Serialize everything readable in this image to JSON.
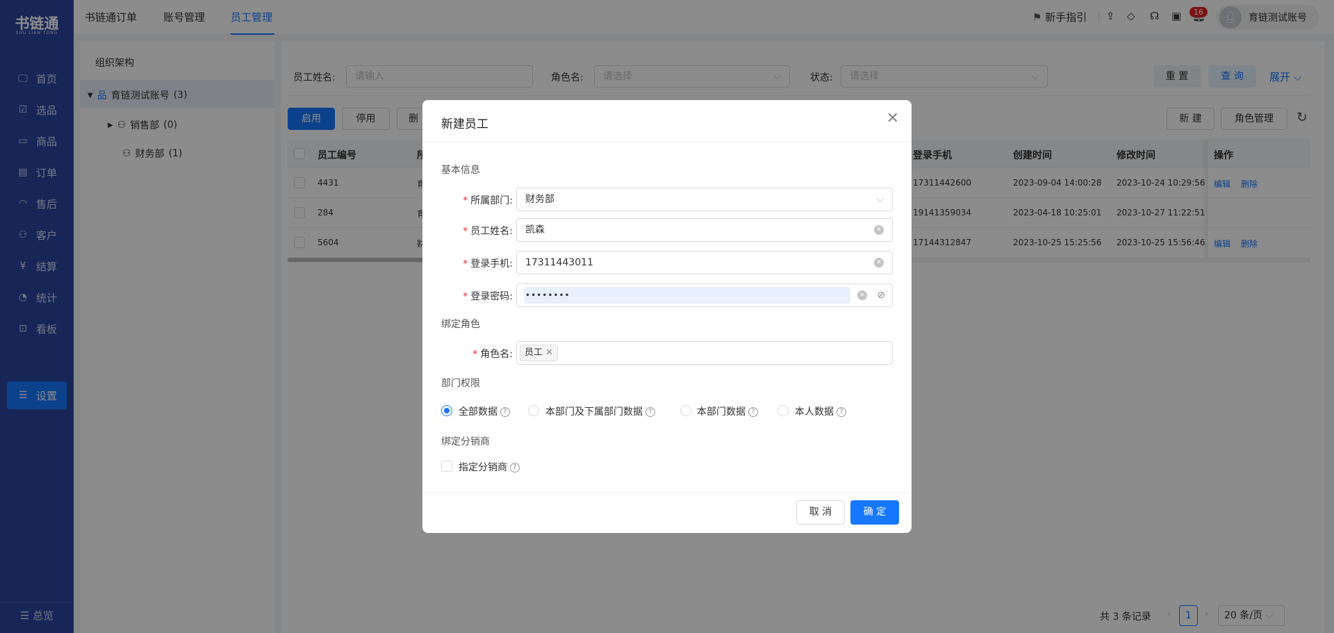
{
  "sidebar": {
    "logo": "书链通",
    "logo_sub": "SHU LIAN TONG",
    "items": [
      {
        "label": "首页",
        "icon": "monitor-icon"
      },
      {
        "label": "选品",
        "icon": "checklist-icon"
      },
      {
        "label": "商品",
        "icon": "box-icon"
      },
      {
        "label": "订单",
        "icon": "order-icon"
      },
      {
        "label": "售后",
        "icon": "headset-icon"
      },
      {
        "label": "客户",
        "icon": "users-icon"
      },
      {
        "label": "结算",
        "icon": "yuan-cycle-icon"
      },
      {
        "label": "统计",
        "icon": "pie-chart-icon"
      },
      {
        "label": "看板",
        "icon": "dashboard-icon"
      },
      {
        "label": "设置",
        "icon": "sliders-icon",
        "active": true
      }
    ],
    "overview": "总览"
  },
  "topbar": {
    "tabs": [
      "书链通订单",
      "账号管理",
      "员工管理"
    ],
    "active_tab": 2,
    "guide": "新手指引",
    "badge": "16",
    "account": "育链测试账号"
  },
  "tree": {
    "title": "组织架构",
    "root": "育链测试账号",
    "root_count": "(3)",
    "children": [
      {
        "label": "销售部",
        "count": "(0)"
      },
      {
        "label": "财务部",
        "count": "(1)"
      }
    ]
  },
  "filters": {
    "name_label": "员工姓名:",
    "name_placeholder": "请输入",
    "role_label": "角色名:",
    "role_placeholder": "请选择",
    "status_label": "状态:",
    "status_placeholder": "请选择",
    "reset": "重 置",
    "query": "查 询",
    "expand": "展开"
  },
  "actions": {
    "enable": "启用",
    "disable": "停用",
    "delete": "删",
    "create": "新 建",
    "roles": "角色管理"
  },
  "table": {
    "headers": [
      "员工编号",
      "所",
      "登录手机",
      "创建时间",
      "修改时间",
      "操作"
    ],
    "rows": [
      {
        "id": "4431",
        "dept": "育",
        "phone": "17311442600",
        "created": "2023-09-04 14:00:28",
        "modified": "2023-10-24 10:29:56",
        "ops": [
          "编辑",
          "删除"
        ]
      },
      {
        "id": "284",
        "dept": "育",
        "phone": "19141359034",
        "created": "2023-04-18 10:25:01",
        "modified": "2023-10-27 11:22:51",
        "ops": []
      },
      {
        "id": "5604",
        "dept": "财",
        "phone": "17144312847",
        "created": "2023-10-25 15:25:56",
        "modified": "2023-10-25 15:56:46",
        "ops": [
          "编辑",
          "删除"
        ]
      }
    ]
  },
  "pagination": {
    "total": "共 3 条记录",
    "page": "1",
    "size": "20 条/页"
  },
  "modal": {
    "title": "新建员工",
    "section_basic": "基本信息",
    "dept_label": "所属部门:",
    "dept_value": "财务部",
    "name_label": "员工姓名:",
    "name_value": "凯森",
    "phone_label": "登录手机:",
    "phone_value": "17311443011",
    "password_label": "登录密码:",
    "password_value": "••••••••",
    "section_role": "绑定角色",
    "role_label": "角色名:",
    "role_tag": "员工",
    "section_perm": "部门权限",
    "perm_options": [
      "全部数据",
      "本部门及下属部门数据",
      "本部门数据",
      "本人数据"
    ],
    "perm_selected": 0,
    "section_dist": "绑定分销商",
    "dist_checkbox": "指定分销商",
    "dist_checked": false,
    "cancel": "取 消",
    "ok": "确 定"
  },
  "colors": {
    "primary": "#1677ff",
    "sidebar": "#2a459e",
    "required": "#f5222d",
    "badge": "#e02020"
  }
}
